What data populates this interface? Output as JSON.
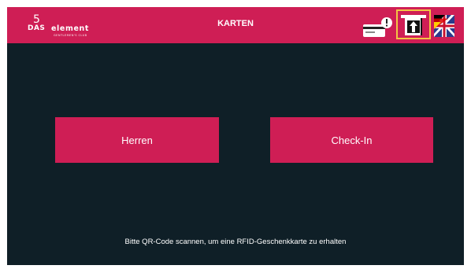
{
  "header": {
    "logo": {
      "word1": "DAS",
      "word2": "element",
      "numeral": "5",
      "tagline": "GENTLEMEN'S CLUB"
    },
    "title": "KARTEN",
    "icons": {
      "card": "card-warning-icon",
      "reader": "card-insert-icon",
      "language": "language-flag-icon"
    }
  },
  "buttons": {
    "herren": "Herren",
    "checkin": "Check-In"
  },
  "footer": {
    "hint": "Bitte QR-Code scannen, um eine RFID-Geschenkkarte zu erhalten"
  },
  "colors": {
    "accent": "#cf1e55",
    "background": "#0f1f27",
    "highlight": "#f2c544"
  }
}
